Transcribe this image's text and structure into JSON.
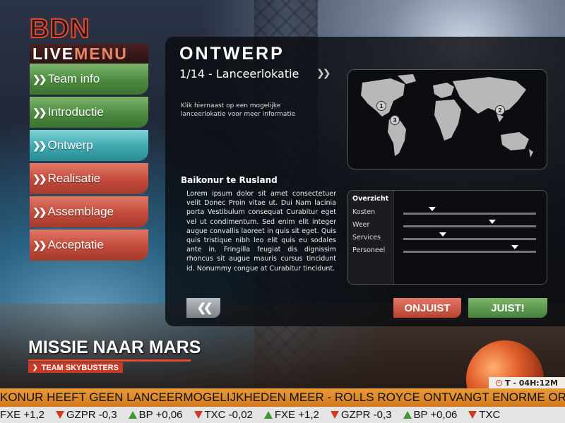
{
  "logo": {
    "bdn": "BDN",
    "live": "LIVE",
    "menu": "MENU"
  },
  "menu": {
    "items": [
      {
        "label": "Team info",
        "color": "green"
      },
      {
        "label": "Introductie",
        "color": "green"
      },
      {
        "label": "Ontwerp",
        "color": "teal"
      },
      {
        "label": "Realisatie",
        "color": "red"
      },
      {
        "label": "Assemblage",
        "color": "red"
      },
      {
        "label": "Acceptatie",
        "color": "red"
      }
    ],
    "chevron": "❯❯"
  },
  "panel": {
    "title": "ONTWERP",
    "subtitle": "1/14 - Lanceerlokatie",
    "instruction": "Klik hiernaast op een mogelijke lanceerlokatie voor meer informatie",
    "location_title": "Baikonur te Rusland",
    "body": "Lorem ipsum dolor sit amet consectetuer velit Donec Proin vitae ut. Dui Nam lacinia porta Vestibulum consequat Curabitur eget vel ut condimentum. Sed enim elit integer augue convallis laoreet in quis sit eget. Quis quis tristique nibh leo elit quis eu sodales ante in. Fringilla feugiat dis dignissim rhoncus sit augue mauris cursus tincidunt id. Nonummy congue at Curabitur tincidunt."
  },
  "map": {
    "pins": [
      {
        "label": "1"
      },
      {
        "label": "2"
      },
      {
        "label": "3"
      }
    ]
  },
  "overview": {
    "heading": "Overzicht",
    "rows": [
      {
        "label": "Kosten",
        "level": 0.22
      },
      {
        "label": "Weer",
        "level": 0.67
      },
      {
        "label": "Services",
        "level": 0.3
      },
      {
        "label": "Personeel",
        "level": 0.84
      }
    ]
  },
  "buttons": {
    "back": "❮❮",
    "wrong": "ONJUIST",
    "right": "JUIST!"
  },
  "mission": {
    "title": "MISSIE NAAR MARS",
    "team": "TEAM SKYBUSTERS"
  },
  "timer": {
    "label": "T - 04H:12M"
  },
  "ticker_news": "KONUR HEEFT GEEN LANCEERMOGELIJKHEDEN MEER  -  ROLLS ROYCE ONTVANGT ENORME ORDER",
  "ticker_stocks": [
    {
      "label": "FXE +1,2",
      "dir": "none"
    },
    {
      "label": "GZPR -0,3",
      "dir": "down"
    },
    {
      "label": "BP +0,06",
      "dir": "up"
    },
    {
      "label": "TXC -0,02",
      "dir": "down"
    },
    {
      "label": "FXE +1,2",
      "dir": "up"
    },
    {
      "label": "GZPR -0,3",
      "dir": "down"
    },
    {
      "label": "BP +0,06",
      "dir": "up"
    },
    {
      "label": "TXC",
      "dir": "down"
    }
  ],
  "colors": {
    "accent_red": "#e8472b",
    "menu_green": "#4c8a3f",
    "menu_teal": "#3ea7b0",
    "menu_red": "#c24a3a",
    "ticker_orange": "#d47a1c"
  }
}
